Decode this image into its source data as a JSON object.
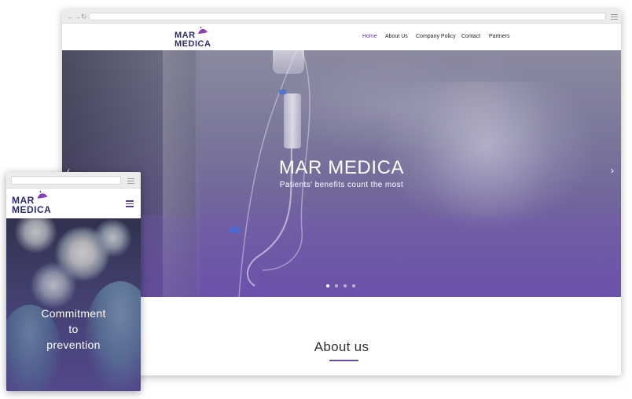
{
  "desktop": {
    "browser": {
      "back_icon": "arrow-left",
      "forward_icon": "arrow-right",
      "reload_icon": "reload",
      "menu_icon": "hamburger"
    },
    "logo": {
      "line1": "MAR",
      "line2": "MEDICA"
    },
    "nav": {
      "items": [
        {
          "label": "Home",
          "active": true
        },
        {
          "label": "About Us",
          "active": false
        },
        {
          "label": "Company Policy",
          "active": false
        },
        {
          "label": "Contact",
          "active": false
        },
        {
          "label": "Partners",
          "active": false
        }
      ]
    },
    "hero": {
      "title": "MAR MEDICA",
      "subtitle": "Patients' benefits count the most",
      "prev_icon": "chevron-left",
      "next_icon": "chevron-right",
      "slides_count": 4,
      "active_slide": 1
    },
    "about": {
      "title": "About us"
    }
  },
  "mobile": {
    "logo": {
      "line1": "MAR",
      "line2": "MEDICA"
    },
    "menu_icon": "hamburger",
    "hero": {
      "line1": "Commitment",
      "line2": "to",
      "line3": "prevention"
    }
  },
  "colors": {
    "brand_navy": "#2b2a6e",
    "brand_purple": "#5b3a9e",
    "logo_accent": "#8a3fb8",
    "accent_line": "#6b4da8"
  }
}
